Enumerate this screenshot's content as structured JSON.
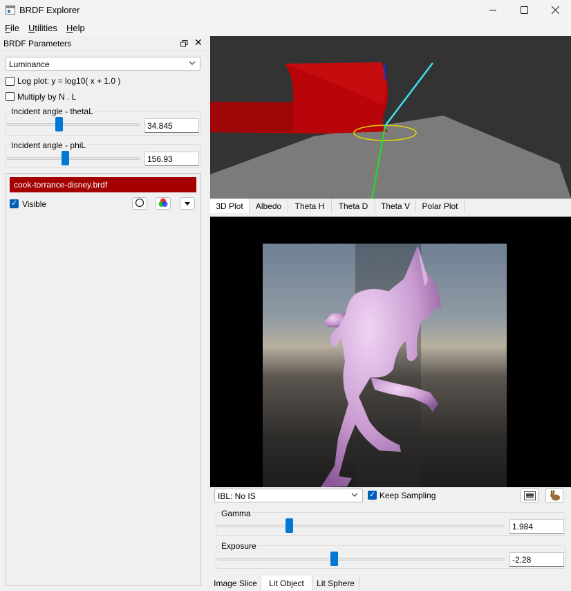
{
  "window": {
    "title": "BRDF Explorer",
    "controls": [
      "minimize",
      "maximize",
      "close"
    ]
  },
  "menu": [
    {
      "label": "File",
      "mnemonic": "F",
      "rest": "ile"
    },
    {
      "label": "Utilities",
      "mnemonic": "U",
      "rest": "tilities"
    },
    {
      "label": "Help",
      "mnemonic": "H",
      "rest": "elp"
    }
  ],
  "dock": {
    "title": "BRDF Parameters",
    "mode_select": "Luminance",
    "log_plot_label": "Log plot:  y = log10( x + 1.0 )",
    "log_plot_checked": false,
    "multiply_label": "Multiply by N . L",
    "multiply_checked": false,
    "theta": {
      "label": "Incident angle - thetaL",
      "value": "34.845",
      "fraction": 0.39
    },
    "phi": {
      "label": "Incident angle - phiL",
      "value": "156.93",
      "fraction": 0.44
    },
    "brdf_file": "cook-torrance-disney.brdf",
    "visible_label": "Visible",
    "visible_checked": true,
    "brdf_color": "#a50000"
  },
  "plot_tabs": [
    "3D Plot",
    "Albedo",
    "Theta H",
    "Theta D",
    "Theta V",
    "Polar Plot"
  ],
  "plot_tab_active": "3D Plot",
  "render": {
    "ibl_select": "IBL: No IS",
    "keep_sampling_label": "Keep Sampling",
    "keep_sampling_checked": true,
    "gamma": {
      "label": "Gamma",
      "value": "1.984",
      "fraction": 0.25
    },
    "exposure": {
      "label": "Exposure",
      "value": "-2.28",
      "fraction": 0.4
    }
  },
  "bottom_tabs": [
    "Image Slice",
    "Lit Object",
    "Lit Sphere"
  ],
  "bottom_tab_active": "Lit Object",
  "colors": {
    "accent": "#0078d4",
    "checkbox": "#005fb8",
    "brdf": "#a50000"
  },
  "icons": [
    "window-icon",
    "minimize-icon",
    "maximize-icon",
    "close-icon",
    "float-icon",
    "circle-icon",
    "color-wheel-icon",
    "dropdown-arrow-icon",
    "image-icon",
    "rabbit-icon"
  ]
}
